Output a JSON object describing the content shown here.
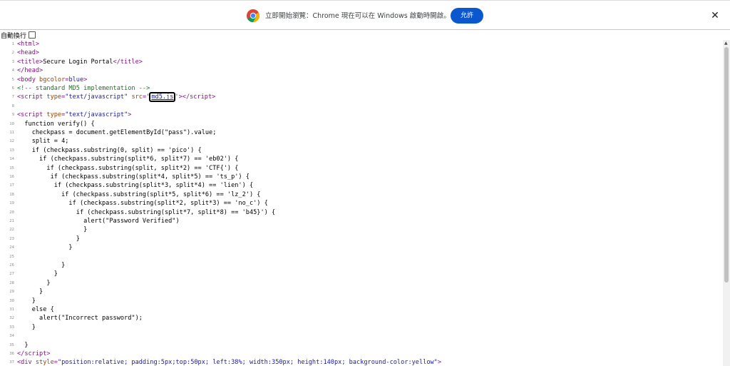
{
  "infobar": {
    "message": "立即開始瀏覽：Chrome 現在可以在 Windows 啟動時開啟。",
    "allow_label": "允許",
    "close_symbol": "✕"
  },
  "wrap_toggle": {
    "label": "自動換行",
    "checked": false
  },
  "source_lines": [
    {
      "n": "1",
      "html": "<span class=\"tag\">&lt;html&gt;</span>"
    },
    {
      "n": "2",
      "html": "<span class=\"tag\">&lt;head&gt;</span>"
    },
    {
      "n": "3",
      "html": "<span class=\"tag\">&lt;title&gt;</span>Secure Login Portal<span class=\"tag\">&lt;/title&gt;</span>"
    },
    {
      "n": "4",
      "html": "<span class=\"tag\">&lt;/head&gt;</span>"
    },
    {
      "n": "5",
      "html": "<span class=\"tag\">&lt;body </span><span class=\"attr\">bgcolor</span><span class=\"tag\">=</span><span class=\"val\">blue</span><span class=\"tag\">&gt;</span>"
    },
    {
      "n": "6",
      "html": "<span class=\"cmt\">&lt;!-- standard MD5 implementation --&gt;</span>"
    },
    {
      "n": "7",
      "html": "<span class=\"tag\">&lt;script </span><span class=\"attr\">type</span><span class=\"tag\">=</span><span class=\"val\">\"text/javascript\"</span><span class=\"tag\"> </span><span class=\"attr\">src</span><span class=\"tag\">=</span><span class=\"val\">'</span><span id=\"md5-link-box\" data-name=\"md5-js-link\" data-interactable=\"true\"><span class=\"lnk\">md5.js</span></span><span class=\"val\">'</span><span class=\"tag\">&gt;&lt;/script&gt;</span>"
    },
    {
      "n": "8",
      "html": ""
    },
    {
      "n": "9",
      "html": "<span class=\"tag\">&lt;script </span><span class=\"attr\">type</span><span class=\"tag\">=</span><span class=\"val\">\"text/javascript\"</span><span class=\"tag\">&gt;</span>"
    },
    {
      "n": "10",
      "html": "  function verify() {"
    },
    {
      "n": "11",
      "html": "    checkpass = document.getElementById(\"pass\").value;"
    },
    {
      "n": "12",
      "html": "    split = 4;"
    },
    {
      "n": "13",
      "html": "    if (checkpass.substring(0, split) == 'pico') {"
    },
    {
      "n": "14",
      "html": "      if (checkpass.substring(split*6, split*7) == 'eb02') {"
    },
    {
      "n": "15",
      "html": "        if (checkpass.substring(split, split*2) == 'CTF{') {"
    },
    {
      "n": "16",
      "html": "         if (checkpass.substring(split*4, split*5) == 'ts_p') {"
    },
    {
      "n": "17",
      "html": "          if (checkpass.substring(split*3, split*4) == 'lien') {"
    },
    {
      "n": "18",
      "html": "            if (checkpass.substring(split*5, split*6) == 'lz_2') {"
    },
    {
      "n": "19",
      "html": "              if (checkpass.substring(split*2, split*3) == 'no_c') {"
    },
    {
      "n": "20",
      "html": "                if (checkpass.substring(split*7, split*8) == 'b45}') {"
    },
    {
      "n": "21",
      "html": "                  alert(\"Password Verified\")"
    },
    {
      "n": "22",
      "html": "                  }"
    },
    {
      "n": "23",
      "html": "                }"
    },
    {
      "n": "24",
      "html": "              }"
    },
    {
      "n": "25",
      "html": ""
    },
    {
      "n": "26",
      "html": "            }"
    },
    {
      "n": "27",
      "html": "          }"
    },
    {
      "n": "28",
      "html": "        }"
    },
    {
      "n": "29",
      "html": "      }"
    },
    {
      "n": "30",
      "html": "    }"
    },
    {
      "n": "31",
      "html": "    else {"
    },
    {
      "n": "32",
      "html": "      alert(\"Incorrect password\");"
    },
    {
      "n": "33",
      "html": "    }"
    },
    {
      "n": "34",
      "html": ""
    },
    {
      "n": "35",
      "html": "  }"
    },
    {
      "n": "36",
      "html": "<span class=\"tag\">&lt;/script&gt;</span>"
    },
    {
      "n": "37",
      "html": "<span class=\"tag\">&lt;div </span><span class=\"attr\">style</span><span class=\"tag\">=</span><span class=\"val\">\"position:relative; padding:5px;top:50px; left:38%; width:350px; height:140px; background-color:yellow\"</span><span class=\"tag\">&gt;</span>"
    }
  ]
}
